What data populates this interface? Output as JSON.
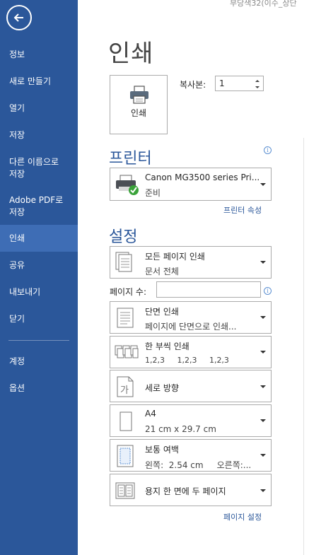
{
  "sidebar": {
    "items": [
      {
        "label": "정보"
      },
      {
        "label": "새로 만들기"
      },
      {
        "label": "열기"
      },
      {
        "label": "저장"
      },
      {
        "label": "다른 이름으로\n저장"
      },
      {
        "label": "Adobe PDF로\n저장"
      },
      {
        "label": "인쇄"
      },
      {
        "label": "공유"
      },
      {
        "label": "내보내기"
      },
      {
        "label": "닫기"
      },
      {
        "label": "계정"
      },
      {
        "label": "옵션"
      }
    ]
  },
  "doc_title": "부당색32(이수_상단",
  "main": {
    "title": "인쇄",
    "print_button": "인쇄",
    "copies_label": "복사본:",
    "copies_value": "1",
    "printer_header": "프린터",
    "printer": {
      "name": "Canon MG3500 series Pri...",
      "status": "준비"
    },
    "printer_properties": "프린터 속성",
    "settings_header": "설정",
    "settings": [
      {
        "l1": "모든 페이지 인쇄",
        "l2": "문서 전체"
      },
      {
        "l1": "단면 인쇄",
        "l2": "페이지에 단면으로 인쇄..."
      },
      {
        "l1": "한 부씩 인쇄",
        "l2": "1,2,3     1,2,3     1,2,3"
      },
      {
        "l1": "세로 방향",
        "l2": ""
      },
      {
        "l1": "A4",
        "l2": "21 cm x 29.7 cm"
      },
      {
        "l1": "보통 여백",
        "l2": "왼쪽:  2.54 cm     오른쪽:..."
      },
      {
        "l1": "용지 한 면에 두 페이지",
        "l2": ""
      }
    ],
    "pages_label": "페이지 수:",
    "pages_value": "",
    "page_setup": "페이지 설정"
  },
  "icons": {
    "back": "back-arrow-icon",
    "printer": "printer-icon",
    "info": "info-icon"
  },
  "colors": {
    "sidebar_bg": "#2b579a",
    "sidebar_active": "#3e6db5",
    "accent": "#2b579a"
  }
}
